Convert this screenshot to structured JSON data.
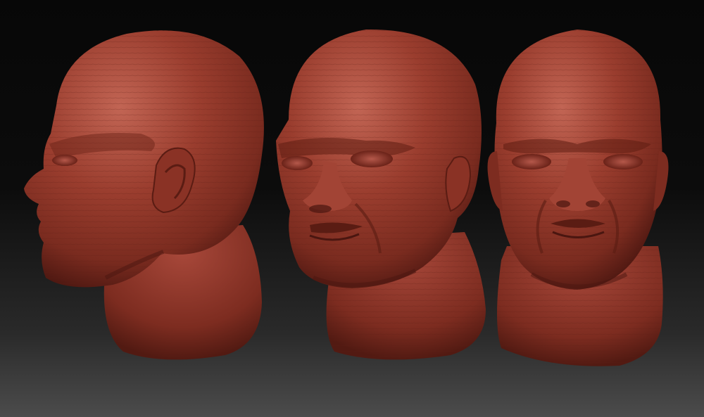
{
  "scene": {
    "views": [
      {
        "id": "side",
        "label": ""
      },
      {
        "id": "three-quarter",
        "label": ""
      },
      {
        "id": "front",
        "label": ""
      }
    ],
    "colors": {
      "background_top": "#070707",
      "background_bottom": "#4c4c4c",
      "clay_base": "#8e3527",
      "clay_highlight": "#c26554",
      "clay_shadow": "#4a1610"
    }
  }
}
